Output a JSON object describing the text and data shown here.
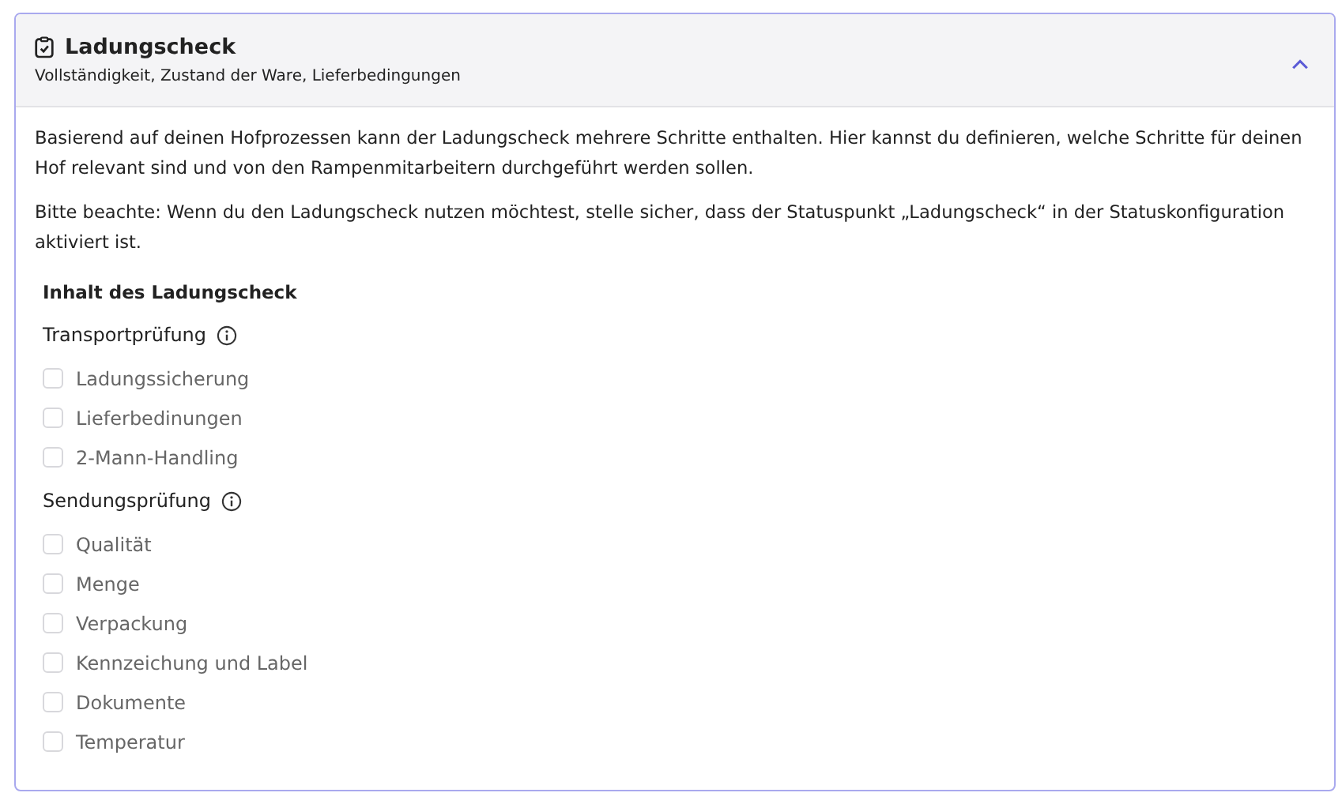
{
  "panel": {
    "title": "Ladungscheck",
    "subtitle": "Vollständigkeit, Zustand der Ware, Lieferbedingungen",
    "expanded": true
  },
  "paragraphs": [
    "Basierend auf deinen Hofprozessen kann der Ladungscheck mehrere Schritte enthalten. Hier kannst du definieren, welche Schritte für deinen Hof relevant sind und von den Rampenmitarbeitern durchgeführt werden sollen.",
    "Bitte beachte: Wenn du den Ladungscheck nutzen möchtest, stelle sicher, dass der Statuspunkt „Ladungscheck“ in der Statuskonfiguration aktiviert ist."
  ],
  "section_title": "Inhalt des Ladungscheck",
  "groups": [
    {
      "label": "Transportprüfung",
      "items": [
        {
          "label": "Ladungssicherung",
          "checked": false,
          "disabled": true
        },
        {
          "label": "Lieferbedinungen",
          "checked": false,
          "disabled": true
        },
        {
          "label": "2-Mann-Handling",
          "checked": false,
          "disabled": true
        }
      ]
    },
    {
      "label": "Sendungsprüfung",
      "items": [
        {
          "label": "Qualität",
          "checked": false,
          "disabled": true
        },
        {
          "label": "Menge",
          "checked": false,
          "disabled": true
        },
        {
          "label": "Verpackung",
          "checked": false,
          "disabled": true
        },
        {
          "label": "Kennzeichung und Label",
          "checked": false,
          "disabled": true
        },
        {
          "label": "Dokumente",
          "checked": false,
          "disabled": true
        },
        {
          "label": "Temperatur",
          "checked": false,
          "disabled": true
        }
      ]
    }
  ]
}
